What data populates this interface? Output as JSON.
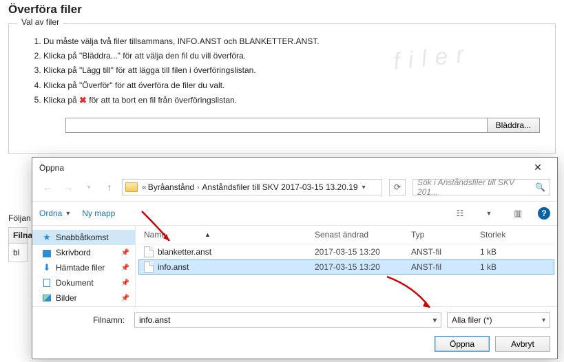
{
  "page": {
    "title": "Överföra filer",
    "fieldset_legend": "Val av filer",
    "watermark": "filer",
    "instructions": [
      "Du måste välja två filer tillsammans, INFO.ANST och BLANKETTER.ANST.",
      "Klicka på \"Bläddra...\" för att välja den fil du vill överföra.",
      "Klicka på \"Lägg till\" för att lägga till filen i överföringslistan.",
      "Klicka på \"Överför\" för att överföra de filer du valt.",
      "Klicka på  "
    ],
    "instruction5_tail": "  för att ta bort en fil från överföringslistan.",
    "browse_button": "Bläddra..."
  },
  "left": {
    "label_prefix": "Följan",
    "th": "Filnam",
    "td": "bl"
  },
  "dialog": {
    "title": "Öppna",
    "breadcrumb": {
      "seg1": "Byråanstånd",
      "seg2": "Anståndsfiler till SKV 2017-03-15 13.20.19"
    },
    "search_placeholder": "Sök i Anståndsfiler till SKV 201...",
    "toolbar": {
      "organize": "Ordna",
      "new_folder": "Ny mapp"
    },
    "sidebar": [
      {
        "label": "Snabbåtkomst",
        "icon": "star",
        "active": true,
        "pin": false
      },
      {
        "label": "Skrivbord",
        "icon": "desk",
        "active": false,
        "pin": true
      },
      {
        "label": "Hämtade filer",
        "icon": "dl",
        "active": false,
        "pin": true
      },
      {
        "label": "Dokument",
        "icon": "doc",
        "active": false,
        "pin": true
      },
      {
        "label": "Bilder",
        "icon": "pic",
        "active": false,
        "pin": true
      }
    ],
    "columns": {
      "name": "Namn",
      "date": "Senast ändrad",
      "type": "Typ",
      "size": "Storlek"
    },
    "files": [
      {
        "name": "blanketter.anst",
        "date": "2017-03-15 13:20",
        "type": "ANST-fil",
        "size": "1 kB",
        "selected": false
      },
      {
        "name": "info.anst",
        "date": "2017-03-15 13:20",
        "type": "ANST-fil",
        "size": "1 kB",
        "selected": true
      }
    ],
    "footer": {
      "filename_label": "Filnamn:",
      "filename_value": "info.anst",
      "filter": "Alla filer (*)",
      "open": "Öppna",
      "cancel": "Avbryt"
    }
  }
}
